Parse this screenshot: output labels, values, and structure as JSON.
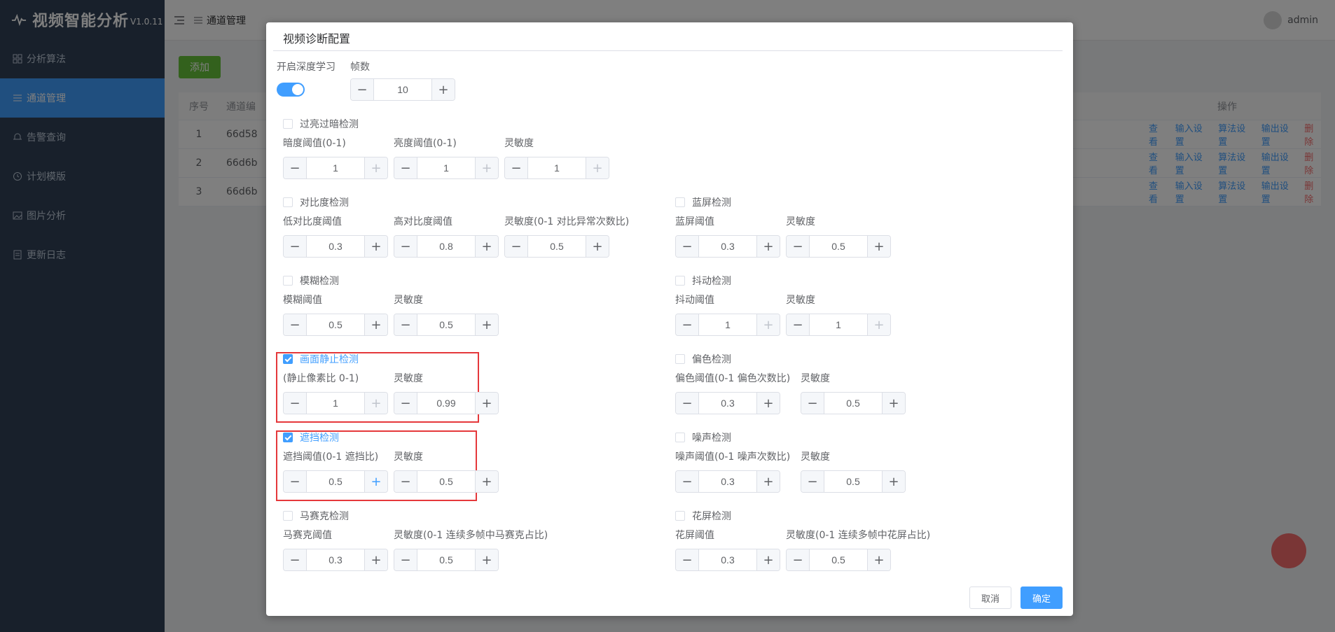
{
  "app": {
    "title": "视频智能分析",
    "version": "V1.0.11"
  },
  "sidebar": {
    "items": [
      {
        "label": "分析算法",
        "icon": "grid-icon",
        "active": false
      },
      {
        "label": "通道管理",
        "icon": "list-icon",
        "active": true
      },
      {
        "label": "告警查询",
        "icon": "bell-icon",
        "active": false
      },
      {
        "label": "计划模版",
        "icon": "clock-icon",
        "active": false
      },
      {
        "label": "图片分析",
        "icon": "image-icon",
        "active": false
      },
      {
        "label": "更新日志",
        "icon": "document-icon",
        "active": false
      }
    ]
  },
  "header": {
    "breadcrumb": "通道管理",
    "user": "admin"
  },
  "main": {
    "add_label": "添加",
    "table": {
      "headers": {
        "no": "序号",
        "id": "通道编",
        "actions": "操作"
      },
      "rows": [
        {
          "no": "1",
          "id": "66d58"
        },
        {
          "no": "2",
          "id": "66d6b"
        },
        {
          "no": "3",
          "id": "66d6b"
        }
      ],
      "actions": {
        "view": "查看",
        "input": "输入设置",
        "algo": "算法设置",
        "output": "输出设置",
        "delete": "删除"
      }
    }
  },
  "dialog": {
    "title": "视频诊断配置",
    "deep_learning_label": "开启深度学习",
    "deep_learning_on": true,
    "frames_label": "帧数",
    "frames_value": "10",
    "sections": {
      "bright_dark": {
        "title": "过亮过暗检测",
        "checked": false,
        "fields": [
          {
            "label": "暗度阈值(0-1)",
            "value": "1"
          },
          {
            "label": "亮度阈值(0-1)",
            "value": "1"
          },
          {
            "label": "灵敏度",
            "value": "1"
          }
        ]
      },
      "contrast": {
        "title": "对比度检测",
        "checked": false,
        "fields": [
          {
            "label": "低对比度阈值",
            "value": "0.3"
          },
          {
            "label": "高对比度阈值",
            "value": "0.8"
          },
          {
            "label": "灵敏度(0-1 对比异常次数比)",
            "value": "0.5"
          }
        ]
      },
      "blue_screen": {
        "title": "蓝屏检测",
        "checked": false,
        "fields": [
          {
            "label": "蓝屏阈值",
            "value": "0.3"
          },
          {
            "label": "灵敏度",
            "value": "0.5"
          }
        ]
      },
      "blur": {
        "title": "模糊检测",
        "checked": false,
        "fields": [
          {
            "label": "模糊阈值",
            "value": "0.5"
          },
          {
            "label": "灵敏度",
            "value": "0.5"
          }
        ]
      },
      "shake": {
        "title": "抖动检测",
        "checked": false,
        "fields": [
          {
            "label": "抖动阈值",
            "value": "1"
          },
          {
            "label": "灵敏度",
            "value": "1"
          }
        ]
      },
      "freeze": {
        "title": "画面静止检测",
        "checked": true,
        "fields": [
          {
            "label": "(静止像素比 0-1)",
            "value": "1"
          },
          {
            "label": "灵敏度",
            "value": "0.99"
          }
        ]
      },
      "color_cast": {
        "title": "偏色检测",
        "checked": false,
        "fields": [
          {
            "label": "偏色阈值(0-1 偏色次数比)",
            "value": "0.3"
          },
          {
            "label": "灵敏度",
            "value": "0.5"
          }
        ]
      },
      "occlusion": {
        "title": "遮挡检测",
        "checked": true,
        "fields": [
          {
            "label": "遮挡阈值(0-1 遮挡比)",
            "value": "0.5"
          },
          {
            "label": "灵敏度",
            "value": "0.5"
          }
        ]
      },
      "noise": {
        "title": "噪声检测",
        "checked": false,
        "fields": [
          {
            "label": "噪声阈值(0-1 噪声次数比)",
            "value": "0.3"
          },
          {
            "label": "灵敏度",
            "value": "0.5"
          }
        ]
      },
      "mosaic": {
        "title": "马赛克检测",
        "checked": false,
        "fields": [
          {
            "label": "马赛克阈值",
            "value": "0.3"
          },
          {
            "label": "灵敏度(0-1 连续多帧中马赛克占比)",
            "value": "0.5"
          }
        ]
      },
      "glitch": {
        "title": "花屏检测",
        "checked": false,
        "fields": [
          {
            "label": "花屏阈值",
            "value": "0.3"
          },
          {
            "label": "灵敏度(0-1 连续多帧中花屏占比)",
            "value": "0.5"
          }
        ]
      }
    },
    "cancel_label": "取消",
    "ok_label": "确定"
  },
  "colors": {
    "primary": "#409eff",
    "sidebar": "#304156",
    "danger": "#f56c6c",
    "success": "#67c23a",
    "highlight": "#e5383b"
  }
}
